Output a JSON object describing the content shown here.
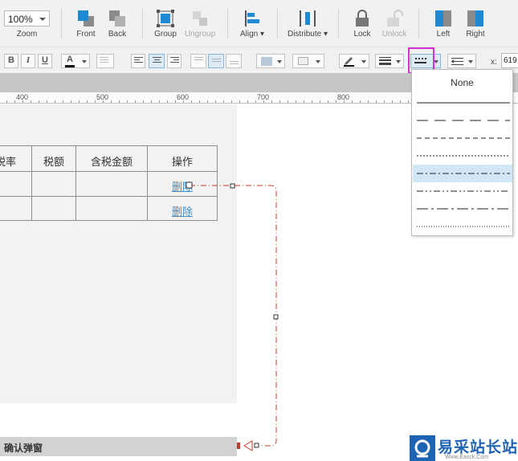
{
  "toolbar": {
    "zoom": {
      "value": "100%",
      "label": "Zoom"
    },
    "buttons": [
      {
        "label": "Front"
      },
      {
        "label": "Back"
      },
      {
        "label": "Group"
      },
      {
        "label": "Ungroup"
      },
      {
        "label": "Align ▾"
      },
      {
        "label": "Distribute ▾"
      },
      {
        "label": "Lock"
      },
      {
        "label": "Unlock"
      },
      {
        "label": "Left"
      },
      {
        "label": "Right"
      }
    ]
  },
  "format_bar": {
    "bold": "B",
    "italic": "I",
    "underline": "U",
    "font_color": "A",
    "x_label": "x:",
    "x_value": "619"
  },
  "ruler": {
    "marks": [
      "400",
      "500",
      "600",
      "700",
      "800"
    ]
  },
  "table": {
    "headers": [
      "税率",
      "税额",
      "含税金额",
      "操作"
    ],
    "links": [
      "删除",
      "删除"
    ]
  },
  "bottom_bar": {
    "label": "确认弹窗"
  },
  "line_style_menu": {
    "none_label": "None",
    "selected_index": 4
  },
  "watermark": {
    "text": "易采站长站",
    "sub": "Www.Easck.Com"
  },
  "colors": {
    "accent": "#1f8ad2",
    "highlight": "#d42fd6",
    "connector": "#c0392b",
    "link": "#3c8ed0"
  }
}
